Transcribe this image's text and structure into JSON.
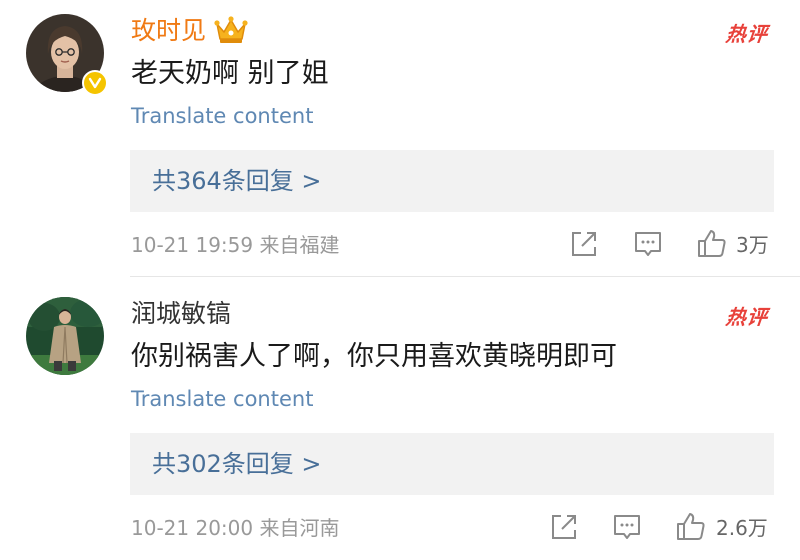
{
  "comments": [
    {
      "username": "玫时见",
      "hot_badge": "热评",
      "text": "老天奶啊 别了姐",
      "translate": "Translate content",
      "replies": "共364条回复 >",
      "time_location": "10-21 19:59  来自福建",
      "likes": "3万"
    },
    {
      "username": "润城敏镐",
      "hot_badge": "热评",
      "text": "你别祸害人了啊，你只用喜欢黄晓明即可",
      "translate": "Translate content",
      "replies": "共302条回复 >",
      "time_location": "10-21 20:00  来自河南",
      "likes": "2.6万"
    }
  ],
  "colors": {
    "vip_username": "#f07a14",
    "username": "#333333",
    "hot_badge": "#e8413a",
    "translate_link": "#5f88b3",
    "replies_text": "#486f98",
    "replies_bg": "#f2f2f2",
    "verified_badge": "#f5c400"
  },
  "icons": {
    "crown": "crown-icon",
    "verified": "verified-badge-icon",
    "share": "share-icon",
    "comment": "comment-icon",
    "like": "like-icon"
  }
}
